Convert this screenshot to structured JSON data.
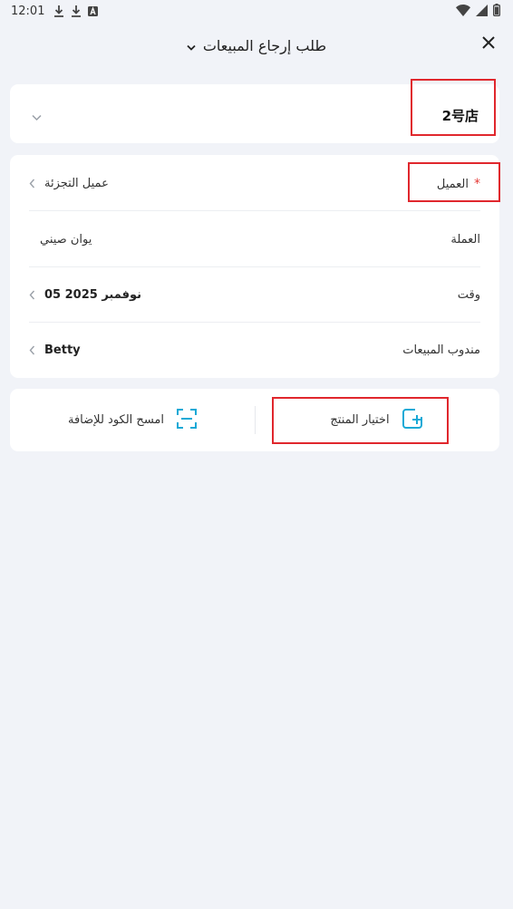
{
  "status_bar": {
    "time": "12:01",
    "icons": [
      "download-icon",
      "download-icon",
      "font-a-icon"
    ],
    "right_icons": [
      "wifi-icon",
      "signal-icon",
      "battery-icon"
    ]
  },
  "header": {
    "title": "طلب إرجاع المبيعات",
    "icons": [
      "chevron-down-icon",
      "close-icon"
    ]
  },
  "store": {
    "name": "2号店"
  },
  "form": {
    "customer_label": "العميل",
    "customer_required": "*",
    "customer_value": "عميل التجزئة",
    "currency_label": "العملة",
    "currency_value": "يوان صيني",
    "time_label": "وقت",
    "time_value": "05 نوفمبر 2025",
    "salesperson_label": "مندوب المبيعات",
    "salesperson_value": "Betty"
  },
  "actions": {
    "select_product": "اختيار المنتج",
    "scan_code": "امسح الكود للإضافة"
  },
  "colors": {
    "background": "#f1f3f8",
    "accent": "#17a9d6",
    "required": "#e53935",
    "highlight": "#e0272d"
  }
}
